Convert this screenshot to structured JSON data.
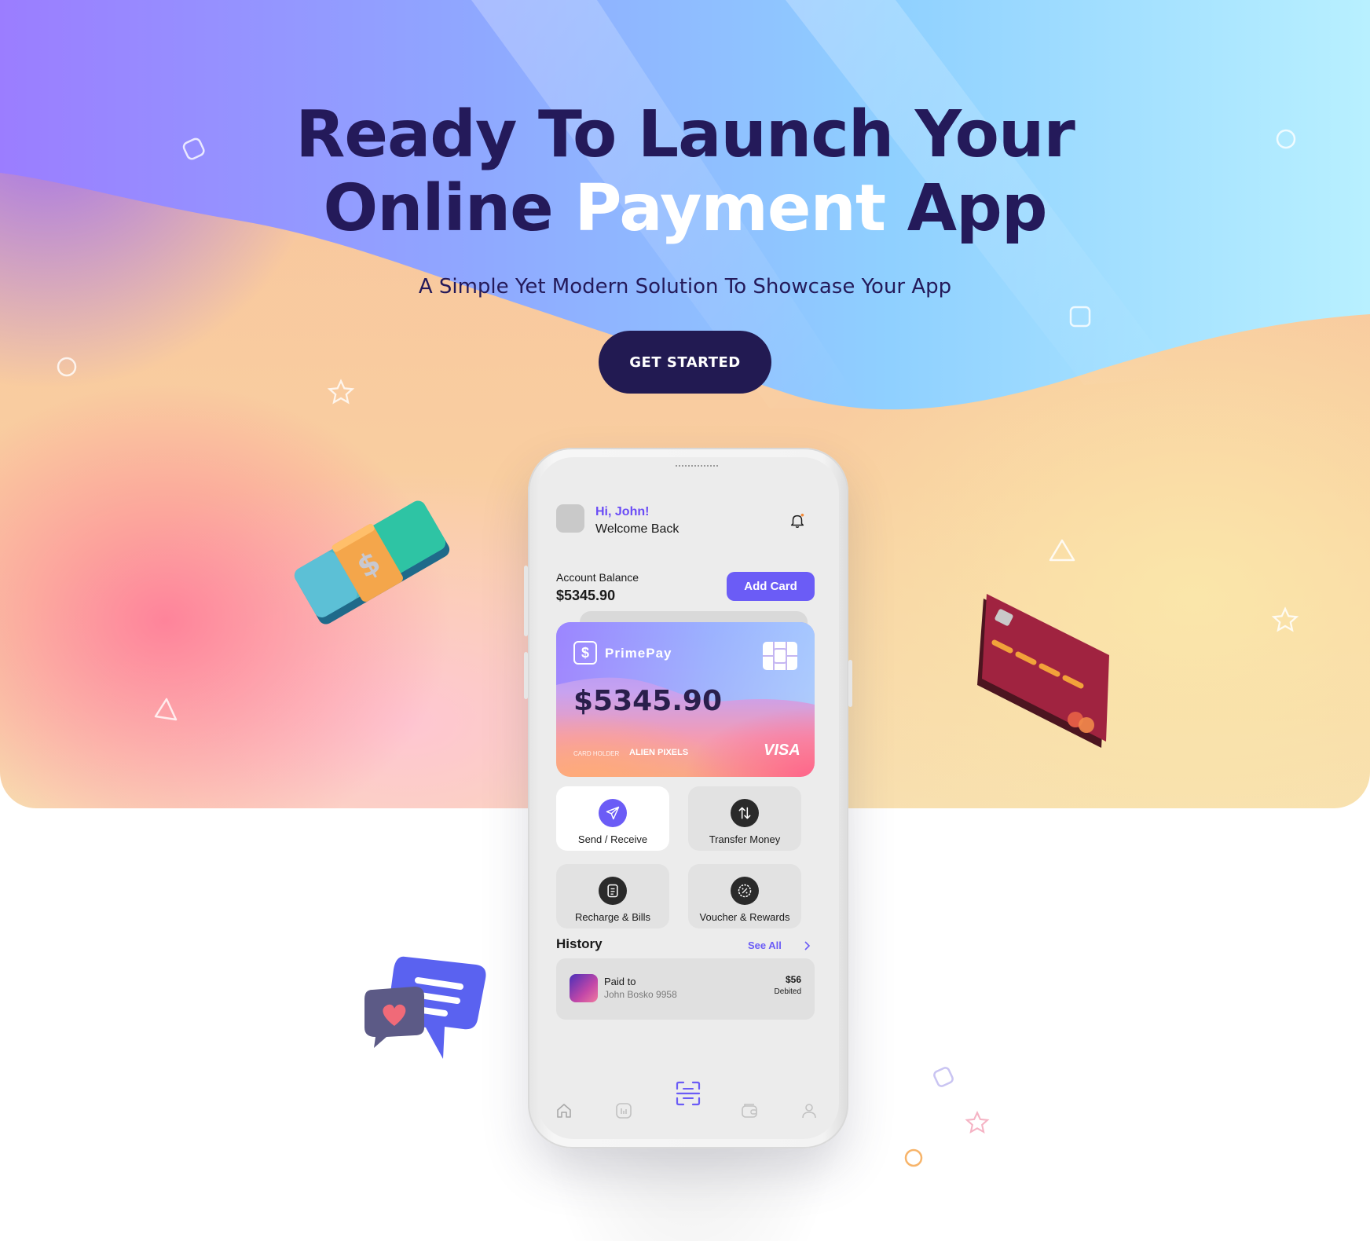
{
  "hero": {
    "headline_line1": "Ready To Launch Your",
    "headline_line2_start": "Online ",
    "headline_line2_accent": "Payment",
    "headline_line2_end": " App",
    "subtitle": "A Simple Yet Modern Solution To Showcase Your App",
    "cta_label": "GET STARTED"
  },
  "phone": {
    "greeting": "Hi, John!",
    "welcome": "Welcome Back",
    "balance_label": "Account Balance",
    "balance_value": "$5345.90",
    "add_card_label": "Add Card",
    "card": {
      "logo_glyph": "$",
      "brand": "PrimePay",
      "amount": "$5345.90",
      "holder_label": "CARD HOLDER",
      "holder_name": "ALIEN PIXELS",
      "network": "VISA"
    },
    "actions": [
      {
        "label": "Send / Receive",
        "icon": "send-icon"
      },
      {
        "label": "Transfer Money",
        "icon": "transfer-icon"
      },
      {
        "label": "Recharge & Bills",
        "icon": "bill-icon"
      },
      {
        "label": "Voucher & Rewards",
        "icon": "voucher-icon"
      }
    ],
    "history": {
      "title": "History",
      "see_all": "See All",
      "items": [
        {
          "label": "Paid to",
          "name": "John Bosko 9958",
          "amount": "$56",
          "status": "Debited"
        }
      ]
    },
    "nav": [
      "home-icon",
      "stats-icon",
      "scan-icon",
      "wallet-icon",
      "profile-icon"
    ]
  },
  "colors": {
    "headline": "#241a5a",
    "accent": "#ffffff",
    "cta_bg": "#221a52",
    "primary": "#6b5cf6"
  }
}
